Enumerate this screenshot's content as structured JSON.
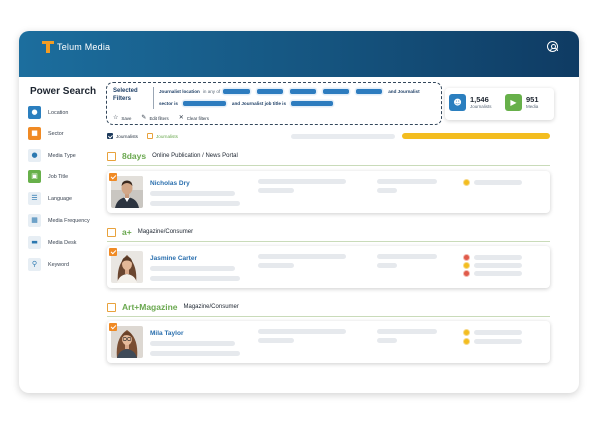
{
  "app": {
    "title": "Telum Media"
  },
  "sidebar": {
    "title": "Power Search",
    "items": [
      {
        "label": "Location",
        "icon": "location-pin-icon",
        "style": "blue"
      },
      {
        "label": "Sector",
        "icon": "briefcase-icon",
        "style": "orange"
      },
      {
        "label": "Media Type",
        "icon": "pin-icon",
        "style": "plain"
      },
      {
        "label": "Job Title",
        "icon": "id-card-icon",
        "style": "green"
      },
      {
        "label": "Language",
        "icon": "language-icon",
        "style": "plain"
      },
      {
        "label": "Media Frequency",
        "icon": "calendar-icon",
        "style": "plain"
      },
      {
        "label": "Media Desk",
        "icon": "desk-icon",
        "style": "plain"
      },
      {
        "label": "Keyword",
        "icon": "key-icon",
        "style": "plain"
      }
    ]
  },
  "filters": {
    "title": "Selected Filters",
    "row1_lead": "Journalist location",
    "row1_in": "in any of",
    "row1_and": "and Journalist",
    "row2_lead": "sector is",
    "row2_and": "and Journalist job title is",
    "actions": {
      "save": "Save",
      "edit": "Edit filters",
      "clear": "Clear filters"
    }
  },
  "stats": {
    "journalists": {
      "value": "1,546",
      "label": "Journalists"
    },
    "media": {
      "value": "951",
      "label": "Media"
    }
  },
  "legend": {
    "checked": "Journalists",
    "unchecked": "Journalists"
  },
  "groups": [
    {
      "name": "8days",
      "type": "Online Publication / News Portal",
      "journalist": "Nicholas Dry"
    },
    {
      "name": "a+",
      "type": "Magazine/Consumer",
      "journalist": "Jasmine Carter"
    },
    {
      "name": "Art+Magazine",
      "type": "Magazine/Consumer",
      "journalist": "Mila Taylor"
    }
  ],
  "colors": {
    "brand": "#15547f",
    "accent_orange": "#f08a24",
    "accent_green": "#6aa84f",
    "link_blue": "#2a6fae"
  }
}
